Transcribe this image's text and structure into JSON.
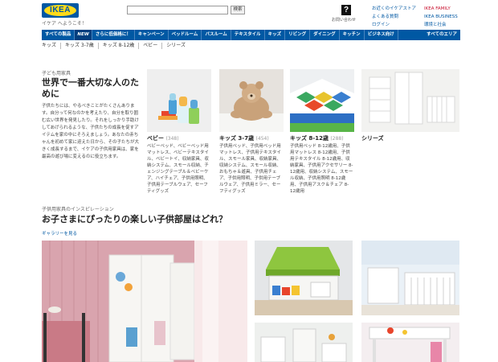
{
  "header": {
    "logo_text": "IKEA",
    "welcome": "イケア へようこそ！",
    "search_placeholder": "",
    "search_button": "検索",
    "contact_label": "お問い合わせ",
    "links_left": [
      "お近くのイケアストア",
      "よくある質問",
      "ログイン"
    ],
    "links_right": [
      "IKEA FAMILY",
      "IKEA BUSINESS",
      "環境と社会"
    ]
  },
  "nav": {
    "items": [
      "すべての製品",
      "NEW",
      "さらに低価格に！",
      "キャンペーン",
      "ベッドルーム",
      "バスルーム",
      "テキスタイル",
      "キッズ",
      "リビング",
      "ダイニング",
      "キッチン",
      "ビジネス向け"
    ],
    "right": "すべてのエリア"
  },
  "subnav": [
    "キッズ",
    "キッズ 3-7歳",
    "キッズ 8-12歳",
    "ベビー",
    "シリーズ"
  ],
  "intro": {
    "label": "子ども用家具",
    "title": "世界で一番大切な人のために",
    "desc": "子供たちには、やるべきことがたくさんあります。自分って何なのかを考えたり、自分を取り囲む広い世界を発見したり。それをしっかり手助けしてあげられるような、子供たちの成長を促すアイテムを家の中にそろえましょう。あなたの赤ちゃんを初めて家に迎えた日から、その子たちが大きく成長するまで、イケアの子供用家具は、家を最高の遊び場に変えるのに役立ちます。"
  },
  "tiles": [
    {
      "title": "ベビー",
      "count": "(348)",
      "desc": "ベビーベッド、ベビーベッド用マットレス、ベビーテキスタイル、ベビートイ、収納家具、収納システム、スモール収納、チェンジングテーブル＆ベビーケア、ハイチェア、子供用照明、子供用テーブルウェア、セーフティグッズ"
    },
    {
      "title": "キッズ 3-7歳",
      "count": "(454)",
      "desc": "子供用ベッド、子供用ベッド用マットレス、子供用テキスタイル、スモール家具、収納家具、収納システム、スモール収納、おもちゃ＆遊具、子供用チェア、子供用照明、子供用テーブルウェア、子供用ミラー、セーフティグッズ"
    },
    {
      "title": "キッズ 8-12歳",
      "count": "(288)",
      "desc": "子供用ベッド 8-12歳用、子供用マットレス 8-12歳用、子供用テキスタイル 8-12歳用、収納家具、子供用アクセサリー 8-12歳用、収納システム、スモール収納、子供用照明 8-12歳用、子供用アスク＆チェア 8-12歳用"
    },
    {
      "title": "シリーズ",
      "count": "",
      "desc": ""
    }
  ],
  "inspiration": {
    "label": "子供用家具のインスピレーション",
    "title": "お子さまにぴったりの楽しい子供部屋はどれ？",
    "link": "ギャラリーを見る"
  },
  "colors": {
    "brand_blue": "#0058a3",
    "brand_yellow": "#ffda1a",
    "family_red": "#c8102e"
  }
}
